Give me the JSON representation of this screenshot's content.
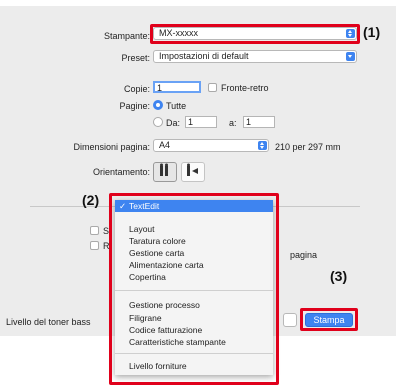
{
  "dialog": {
    "stampante": {
      "label": "Stampante:",
      "value": "MX-xxxxx"
    },
    "preset": {
      "label": "Preset:",
      "value": "Impostazioni di default"
    },
    "copie": {
      "label": "Copie:",
      "value": "1",
      "fronte_retro": "Fronte-retro"
    },
    "pagine": {
      "label": "Pagine:",
      "tutte": "Tutte",
      "da": "Da:",
      "da_value": "1",
      "a": "a:",
      "a_value": "1"
    },
    "dimensioni": {
      "label": "Dimensioni pagina:",
      "value": "A4",
      "size_text": "210 per 297 mm"
    },
    "orientamento": {
      "label": "Orientamento:"
    },
    "partial_s": "S",
    "partial_r": "R",
    "partial_pagina": "pagina",
    "toner_label": "Livello del toner bass",
    "stampa_button": "Stampa"
  },
  "menu": {
    "selected": "TextEdit",
    "group1": [
      "Layout",
      "Taratura colore",
      "Gestione carta",
      "Alimentazione carta",
      "Copertina"
    ],
    "group2": [
      "Gestione processo",
      "Filigrane",
      "Codice fatturazione",
      "Caratteristiche stampante"
    ],
    "group3": [
      "Livello forniture"
    ]
  },
  "callouts": {
    "c1": "(1)",
    "c2": "(2)",
    "c3": "(3)"
  },
  "colors": {
    "accent": "#3e84f0",
    "highlight_box": "#e0001b"
  }
}
